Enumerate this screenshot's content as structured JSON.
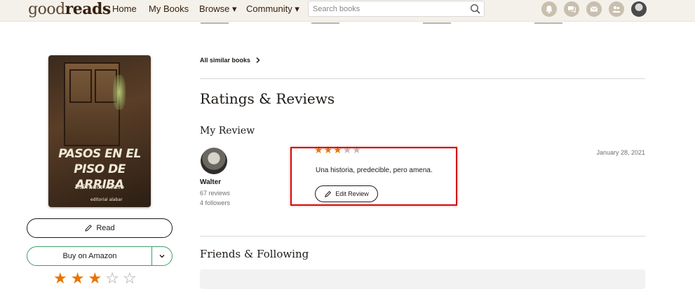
{
  "header": {
    "logo_light": "good",
    "logo_bold": "reads",
    "nav": {
      "home": "Home",
      "my_books": "My Books",
      "browse": "Browse ▾",
      "community": "Community ▾"
    },
    "search_placeholder": "Search books",
    "icons": [
      "bell-icon",
      "comments-icon",
      "mail-icon",
      "friends-icon",
      "profile-avatar"
    ]
  },
  "book": {
    "cover_title_line1": "PASOS EN EL",
    "cover_title_line2": "PISO DE ARRIBA",
    "cover_author": "Salvador Acaso",
    "cover_publisher": "editorial  alabar",
    "read_button": "Read",
    "buy_button": "Buy on Amazon",
    "rating_stars": 3,
    "rating_max": 5
  },
  "similar": {
    "link": "All similar books"
  },
  "ratings_reviews": {
    "heading": "Ratings & Reviews",
    "my_review_heading": "My Review",
    "reviewer": {
      "name": "Walter",
      "reviews": "67 reviews",
      "followers": "4 followers"
    },
    "review": {
      "stars": 3,
      "max": 5,
      "date": "January 28, 2021",
      "text": "Una historia, predecible, pero amena.",
      "edit_button": "Edit Review"
    }
  },
  "friends": {
    "heading": "Friends & Following"
  },
  "colors": {
    "header_bg": "#f4f1ea",
    "star_on": "#e87400",
    "amazon_border": "#409d69",
    "highlight": "#d40c0c"
  }
}
